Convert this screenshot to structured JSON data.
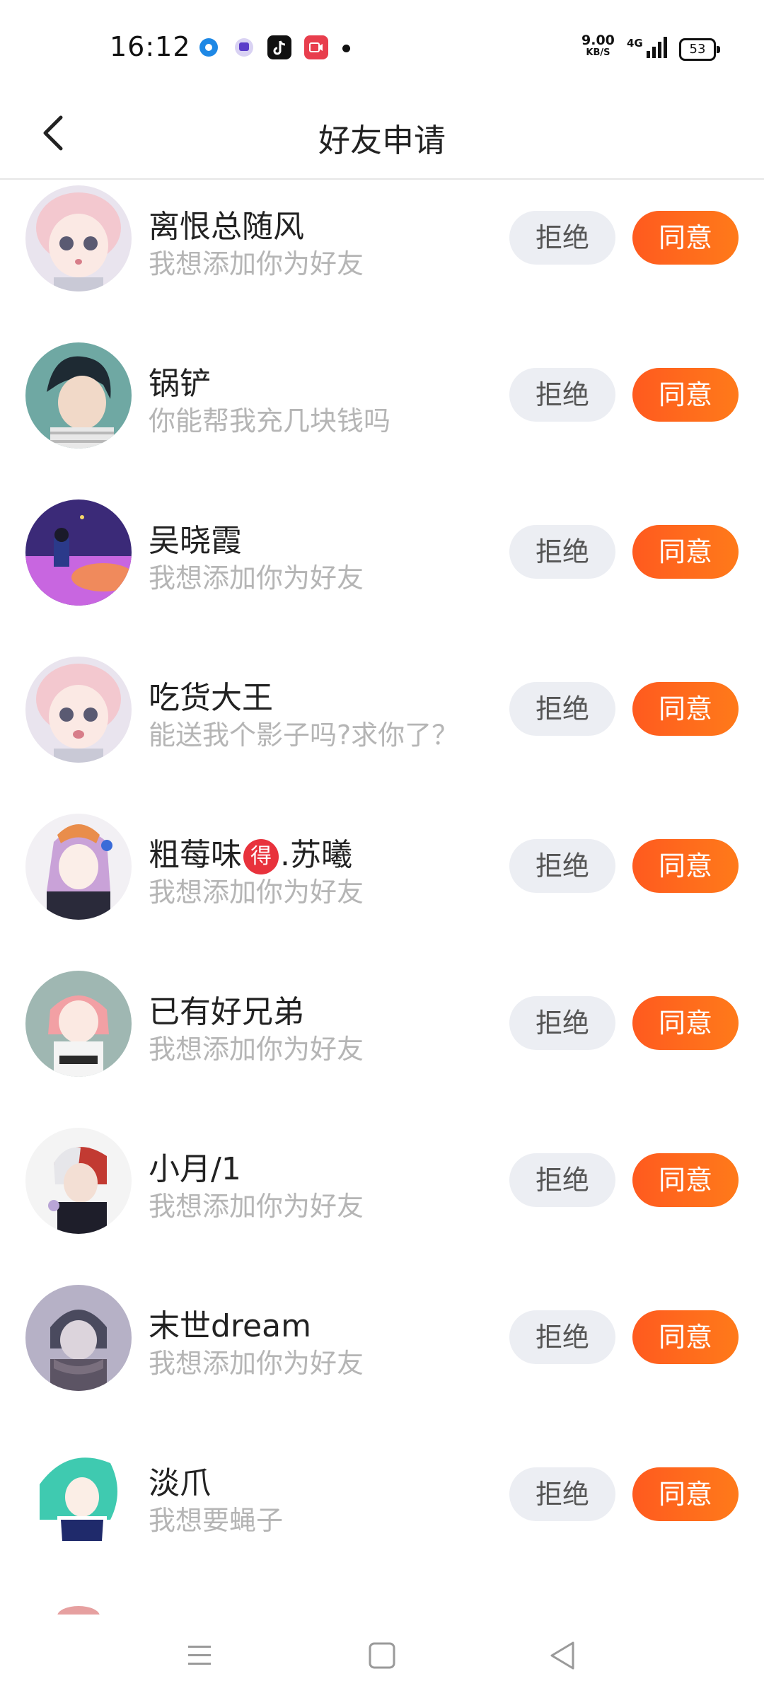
{
  "status_bar": {
    "time": "16:12",
    "net_speed": "9.00",
    "net_speed_unit": "KB/S",
    "network": "4G",
    "battery": "53"
  },
  "header": {
    "title": "好友申请"
  },
  "buttons": {
    "reject": "拒绝",
    "accept": "同意"
  },
  "requests": [
    {
      "name": "离恨总随风",
      "message": "我想添加你为好友"
    },
    {
      "name": "锅铲",
      "message": "你能帮我充几块钱吗"
    },
    {
      "name": "吴晓霞",
      "message": "我想添加你为好友"
    },
    {
      "name": "吃货大王",
      "message": "能送我个影子吗?求你了？"
    },
    {
      "name_prefix": "粗莓味",
      "name_badge": "得",
      "name_suffix": ".苏曦",
      "message": "我想添加你为好友"
    },
    {
      "name": "已有好兄弟",
      "message": "我想添加你为好友"
    },
    {
      "name": "小月/1",
      "message": "我想添加你为好友"
    },
    {
      "name": "末世dream",
      "message": "我想添加你为好友"
    },
    {
      "name": "淡爪",
      "message": "我想要蝇子"
    }
  ],
  "colors": {
    "accent": "#ff6a1a",
    "reject_bg": "#eceef3",
    "muted_text": "#b5b5b5"
  }
}
